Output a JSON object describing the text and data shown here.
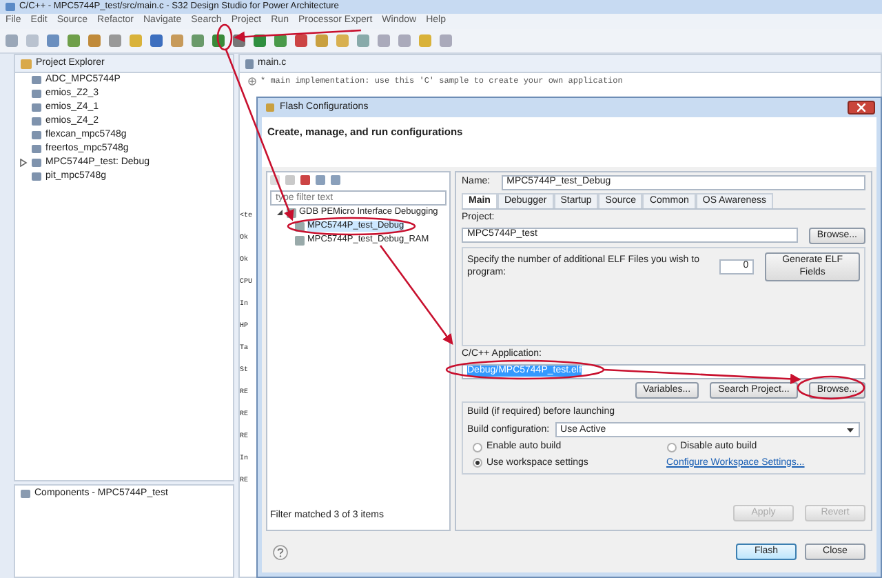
{
  "window": {
    "title": "C/C++ - MPC5744P_test/src/main.c - S32 Design Studio for Power Architecture"
  },
  "menu": [
    "File",
    "Edit",
    "Source",
    "Refactor",
    "Navigate",
    "Search",
    "Project",
    "Run",
    "Processor Expert",
    "Window",
    "Help"
  ],
  "project_explorer": {
    "title": "Project Explorer",
    "items": [
      {
        "label": "ADC_MPC5744P",
        "expandable": false
      },
      {
        "label": "emios_Z2_3",
        "expandable": false
      },
      {
        "label": "emios_Z4_1",
        "expandable": false
      },
      {
        "label": "emios_Z4_2",
        "expandable": false
      },
      {
        "label": "flexcan_mpc5748g",
        "expandable": false
      },
      {
        "label": "freertos_mpc5748g",
        "expandable": false
      },
      {
        "label": "MPC5744P_test: Debug",
        "expandable": true
      },
      {
        "label": "pit_mpc5748g",
        "expandable": false
      }
    ]
  },
  "components": {
    "title": "Components - MPC5744P_test"
  },
  "editor": {
    "tab": "main.c",
    "lines": [
      "* main implementation: use this 'C' sample to create your own application"
    ]
  },
  "console": {
    "lines": [
      "<te",
      "Ok",
      "Ok",
      "CPU",
      "In",
      "HP",
      "Ta",
      "St",
      "RE",
      "RE",
      "RE",
      "In",
      "RE"
    ]
  },
  "dialog": {
    "title": "Flash Configurations",
    "heading": "Create, manage, and run configurations",
    "filter": {
      "placeholder": "type filter text"
    },
    "tree": [
      {
        "label": "GDB PEMicro Interface Debugging",
        "expanded": true,
        "selected": false,
        "children": [
          {
            "label": "MPC5744P_test_Debug",
            "selected": true
          },
          {
            "label": "MPC5744P_test_Debug_RAM",
            "selected": false
          }
        ]
      }
    ],
    "filter_status": "Filter matched 3 of 3 items",
    "name_label": "Name:",
    "name": "MPC5744P_test_Debug",
    "tabs": [
      {
        "label": "Main",
        "selected": true
      },
      {
        "label": "Debugger",
        "selected": false
      },
      {
        "label": "Startup",
        "selected": false
      },
      {
        "label": "Source",
        "selected": false
      },
      {
        "label": "Common",
        "selected": false
      },
      {
        "label": "OS Awareness",
        "selected": false
      }
    ],
    "project_label": "Project:",
    "project": "MPC5744P_test",
    "project_browse": "Browse...",
    "elf_prompt": "Specify the number of additional ELF Files you wish to program:",
    "elf_count": "0",
    "elf_button": "Generate ELF Fields",
    "app_label": "C/C++ Application:",
    "app": "Debug/MPC5744P_test.elf",
    "app_text_selected": true,
    "app_buttons": [
      "Variables...",
      "Search Project...",
      "Browse..."
    ],
    "build_heading": "Build (if required) before launching",
    "build_config_label": "Build configuration:",
    "build_config": "Use Active",
    "radios": [
      {
        "label": "Enable auto build",
        "selected": false
      },
      {
        "label": "Disable auto build",
        "selected": false
      },
      {
        "label": "Use workspace settings",
        "selected": true
      }
    ],
    "workspace_link": "Configure Workspace Settings...",
    "apply_buttons": [
      {
        "label": "Apply",
        "disabled": true
      },
      {
        "label": "Revert",
        "disabled": true
      }
    ],
    "footer_buttons": [
      {
        "label": "Flash",
        "default": true
      },
      {
        "label": "Close",
        "default": false
      }
    ]
  }
}
